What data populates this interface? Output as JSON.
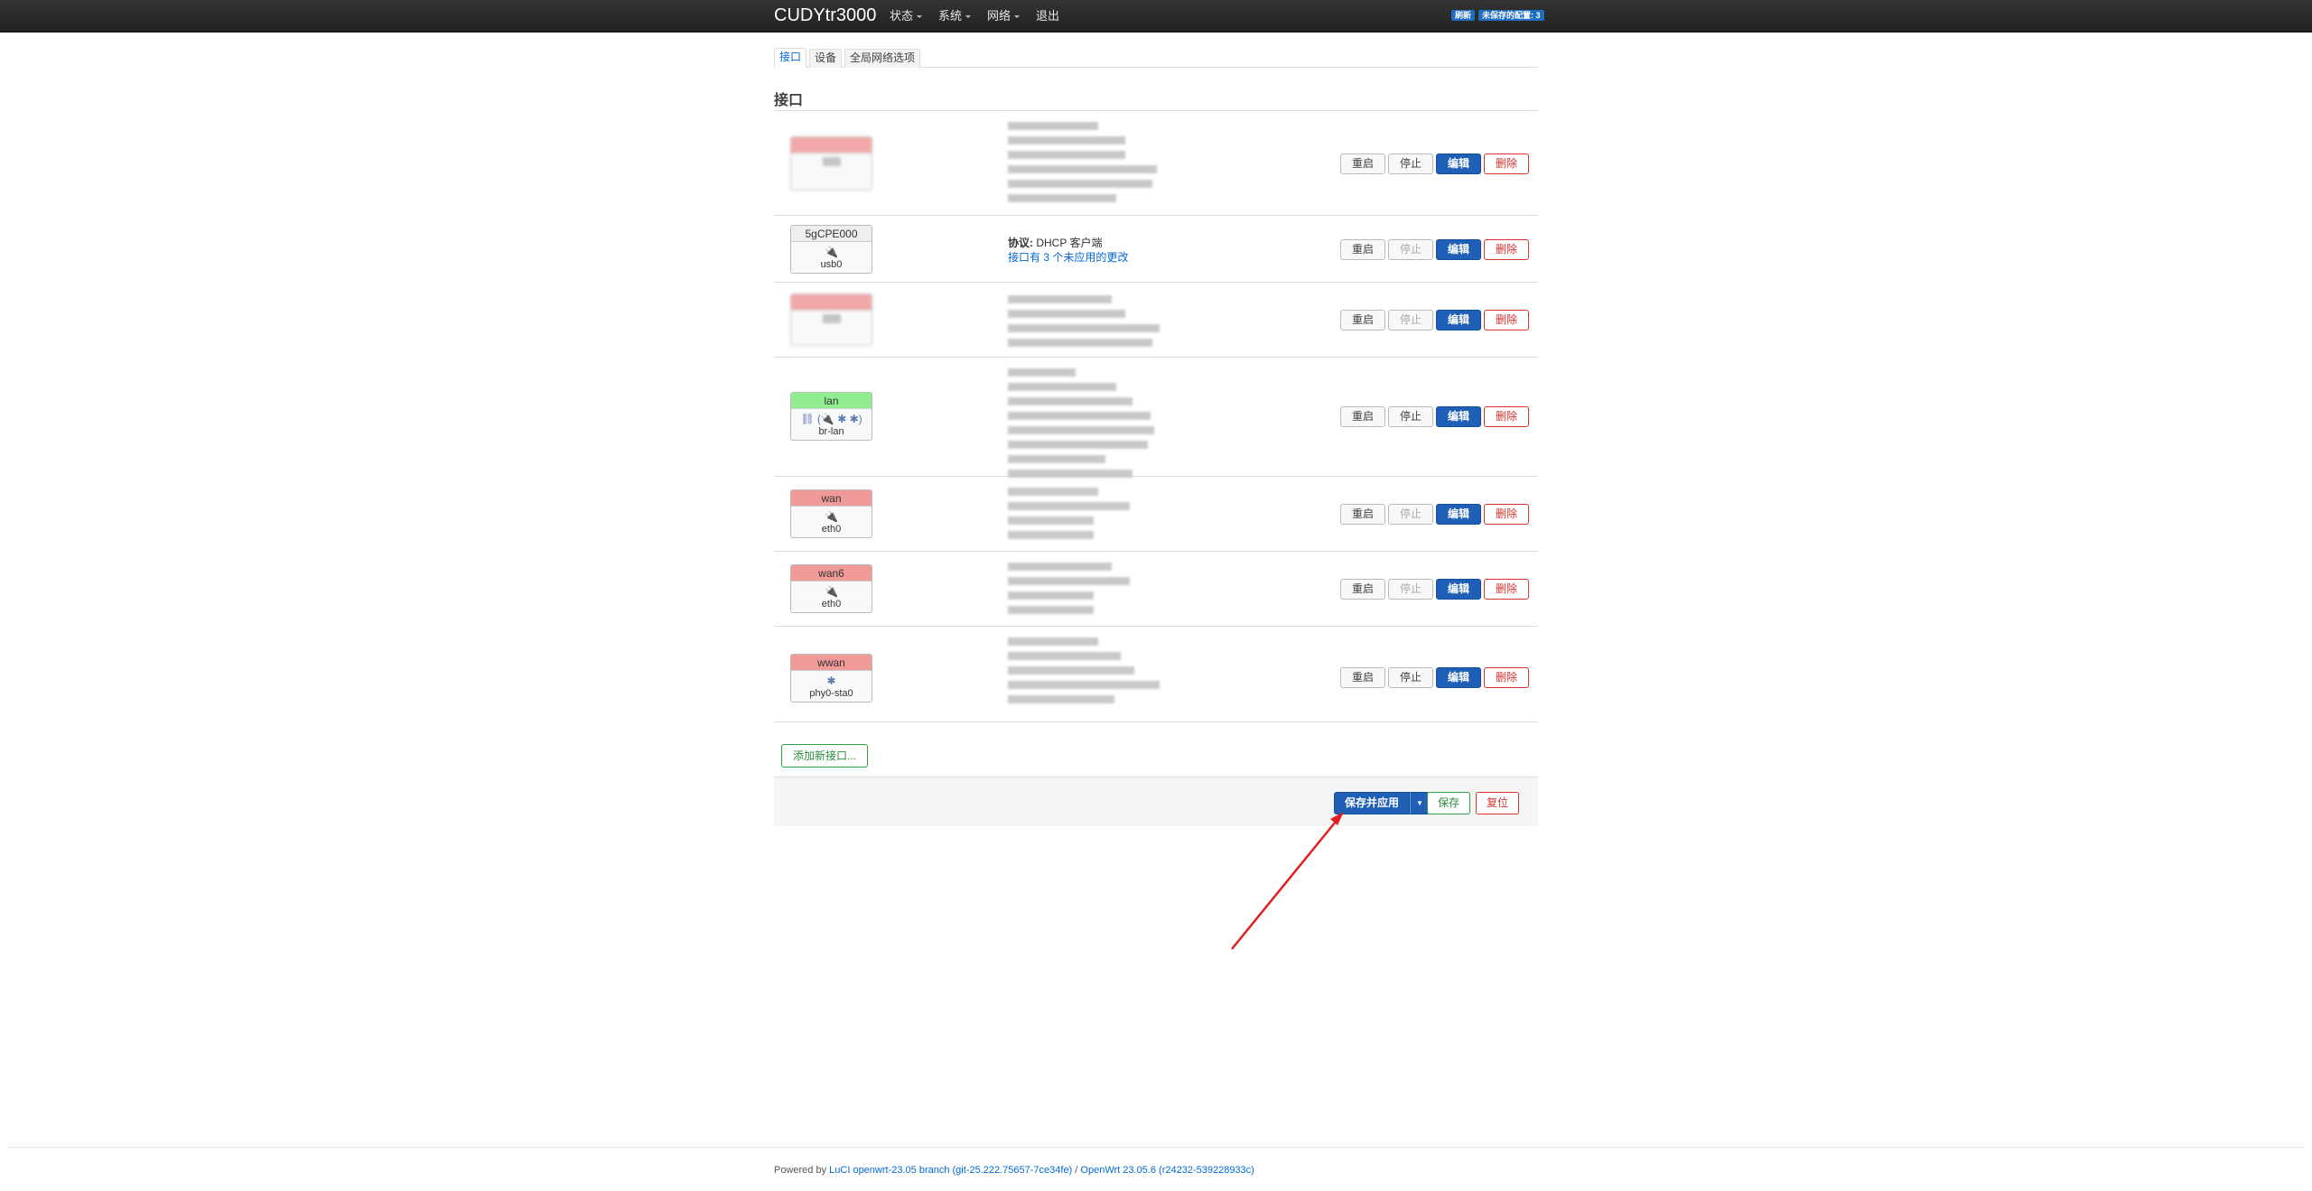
{
  "navbar": {
    "brand": "CUDYtr3000",
    "menu": [
      {
        "label": "状态"
      },
      {
        "label": "系统"
      },
      {
        "label": "网络"
      },
      {
        "label": "退出"
      }
    ],
    "indicators": [
      "刷新",
      "未保存的配置: 3"
    ]
  },
  "tabs": [
    {
      "label": "接口",
      "active": true
    },
    {
      "label": "设备",
      "active": false
    },
    {
      "label": "全局网络选项",
      "active": false
    }
  ],
  "section_title": "接口",
  "interfaces": [
    {
      "name": "",
      "device": "",
      "blurred": true
    },
    {
      "name": "5gCPE000",
      "device": "usb0",
      "protocol_label": "协议:",
      "protocol_value": " DHCP 客户端",
      "pending": "接口有 3 个未应用的更改"
    },
    {
      "name": "",
      "device": "",
      "blurred": true
    },
    {
      "name": "lan",
      "device": "br-lan",
      "icons": "⛓ (🔌 ✱ ✱)"
    },
    {
      "name": "wan",
      "device": "eth0"
    },
    {
      "name": "wan6",
      "device": "eth0"
    },
    {
      "name": "wwan",
      "device": "phy0-sta0"
    }
  ],
  "row_actions": {
    "restart": "重启",
    "stop": "停止",
    "edit": "编辑",
    "delete": "删除"
  },
  "add_interface": "添加新接口...",
  "action_bar": {
    "save_apply": "保存并应用",
    "dropdown_icon": "caret-down-icon",
    "save": "保存",
    "reset": "复位"
  },
  "footer": {
    "powered_by": "Powered by ",
    "luci_link": "LuCI openwrt-23.05 branch (git-25.222.75657-7ce34fe)",
    "separator": " / ",
    "openwrt_link": "OpenWrt 23.05.6 (r24232-539228933c)"
  },
  "colors": {
    "navbar": "#222222",
    "primary": "#1f5fb5",
    "danger": "#d9322e",
    "success": "#2ea043",
    "zone_red": "#f09a9a",
    "zone_green": "#90ee90"
  }
}
